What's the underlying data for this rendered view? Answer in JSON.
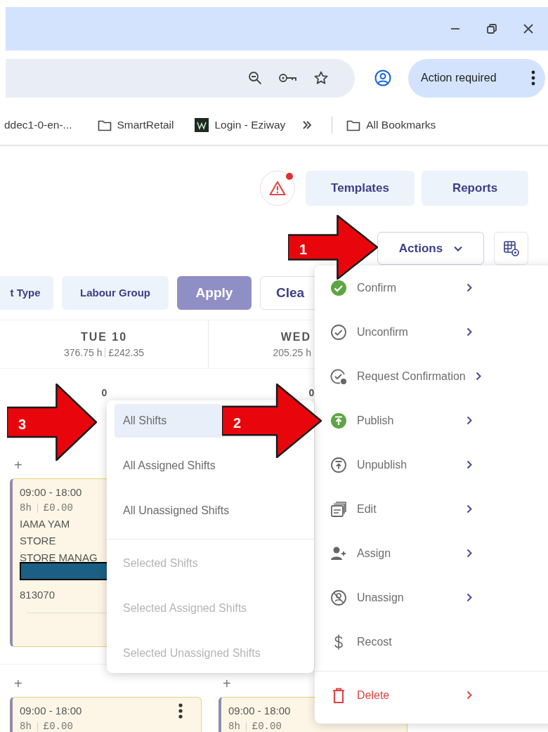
{
  "browser": {
    "action_chip": {
      "label": "Action required"
    },
    "bookmarks": [
      {
        "label": "ddec1-0-en-...",
        "kind": "plain"
      },
      {
        "label": "SmartRetail",
        "kind": "folder"
      },
      {
        "label": "Login - Eziway",
        "kind": "site"
      }
    ],
    "all_bookmarks": {
      "label": "All Bookmarks"
    }
  },
  "alert_button": {
    "notification": true
  },
  "header_buttons": [
    {
      "label": "Templates"
    },
    {
      "label": "Reports"
    }
  ],
  "actions_button": {
    "label": "Actions",
    "expanded": true
  },
  "filters": [
    {
      "label": "t Type",
      "kind": "chip"
    },
    {
      "label": "Labour Group",
      "kind": "chip"
    },
    {
      "label": "Apply",
      "kind": "primary"
    },
    {
      "label": "Clea",
      "kind": "outline"
    }
  ],
  "days": [
    {
      "label": "TUE 10",
      "hours": "376.75 h",
      "cost": "£242.35",
      "count": "0"
    },
    {
      "label": "WED",
      "hours": "205.25 h",
      "count": "0"
    }
  ],
  "shift_rows": [
    {
      "cells": [
        {
          "add": "+",
          "shifts": [
            {
              "time": "09:00 - 18:00",
              "hours": "8h",
              "cost": "£0.00",
              "lines": [
                "IAMA YAM",
                "STORE",
                "STORE MANAG"
              ],
              "redacted": true,
              "code": "813070"
            }
          ]
        }
      ]
    },
    {
      "cells": [
        {
          "add": "+",
          "shifts": [
            {
              "time": "09:00 - 18:00",
              "hours": "8h",
              "cost": "£0.00",
              "menu": true
            }
          ]
        },
        {
          "add": "+",
          "shifts": [
            {
              "time": "09:00 - 18:00",
              "hours": "8h",
              "cost": "£0.00"
            }
          ]
        }
      ]
    }
  ],
  "actions_menu": [
    {
      "label": "Confirm",
      "kind": "confirm",
      "submenu": true
    },
    {
      "label": "Unconfirm",
      "kind": "unconfirm",
      "submenu": true
    },
    {
      "label": "Request Confirmation",
      "kind": "request",
      "submenu": true
    },
    {
      "label": "Publish",
      "kind": "publish",
      "submenu": true
    },
    {
      "label": "Unpublish",
      "kind": "unpublish",
      "submenu": true
    },
    {
      "label": "Edit",
      "kind": "edit",
      "submenu": true
    },
    {
      "label": "Assign",
      "kind": "assign",
      "submenu": true
    },
    {
      "label": "Unassign",
      "kind": "unassign",
      "submenu": true
    },
    {
      "label": "Recost",
      "kind": "recost",
      "submenu": false
    },
    {
      "label": "Delete",
      "kind": "delete",
      "submenu": true
    }
  ],
  "publish_submenu": [
    [
      {
        "label": "All Shifts",
        "selected": true,
        "disabled": false
      },
      {
        "label": "All Assigned Shifts",
        "selected": false,
        "disabled": false
      },
      {
        "label": "All Unassigned Shifts",
        "selected": false,
        "disabled": false
      }
    ],
    [
      {
        "label": "Selected Shifts",
        "selected": false,
        "disabled": true
      },
      {
        "label": "Selected Assigned Shifts",
        "selected": false,
        "disabled": true
      },
      {
        "label": "Selected Unassigned Shifts",
        "selected": false,
        "disabled": true
      }
    ]
  ],
  "annotations": [
    {
      "label": "1"
    },
    {
      "label": "2"
    },
    {
      "label": "3"
    }
  ]
}
